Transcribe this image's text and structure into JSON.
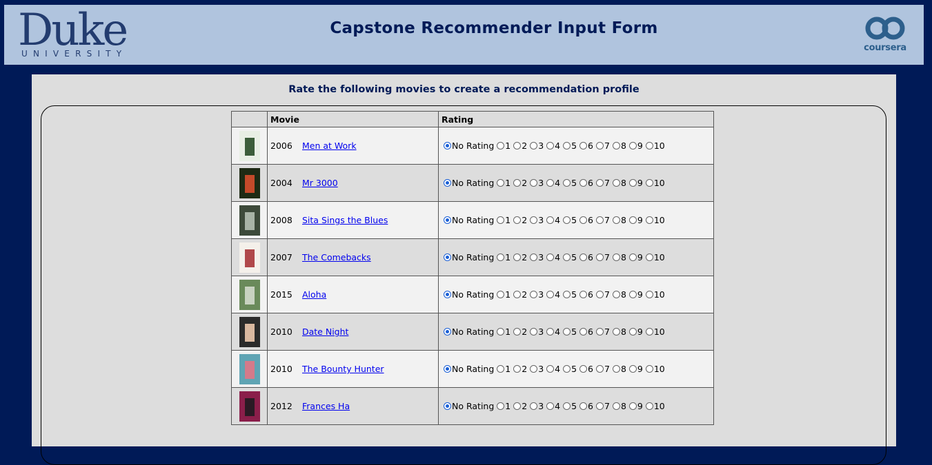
{
  "header": {
    "duke_word": "Duke",
    "duke_sub": "UNIVERSITY",
    "title": "Capstone Recommender Input Form",
    "coursera_word": "coursera"
  },
  "main": {
    "subtitle": "Rate the following movies to create a recommendation profile",
    "columns": [
      "Movie",
      "Rating"
    ],
    "rating_options": [
      "No Rating",
      "1",
      "2",
      "3",
      "4",
      "5",
      "6",
      "7",
      "8",
      "9",
      "10"
    ],
    "selected_rating": "No Rating",
    "movies": [
      {
        "year": "2006",
        "title": "Men at Work",
        "poster_colors": [
          "#e8efe4",
          "#3c5e3a"
        ]
      },
      {
        "year": "2004",
        "title": "Mr 3000",
        "poster_colors": [
          "#1e2a14",
          "#c44a2a"
        ]
      },
      {
        "year": "2008",
        "title": "Sita Sings the Blues",
        "poster_colors": [
          "#3d4a3a",
          "#a8b3a6"
        ]
      },
      {
        "year": "2007",
        "title": "The Comebacks",
        "poster_colors": [
          "#f4f0ea",
          "#b0484a"
        ]
      },
      {
        "year": "2015",
        "title": "Aloha",
        "poster_colors": [
          "#6a8a5a",
          "#c8d2c0"
        ]
      },
      {
        "year": "2010",
        "title": "Date Night",
        "poster_colors": [
          "#2b2b2b",
          "#d9b8a0"
        ]
      },
      {
        "year": "2010",
        "title": "The Bounty Hunter",
        "poster_colors": [
          "#5fa4b4",
          "#d47a8a"
        ]
      },
      {
        "year": "2012",
        "title": "Frances Ha",
        "poster_colors": [
          "#8a1e4a",
          "#2a1a24"
        ]
      }
    ]
  }
}
